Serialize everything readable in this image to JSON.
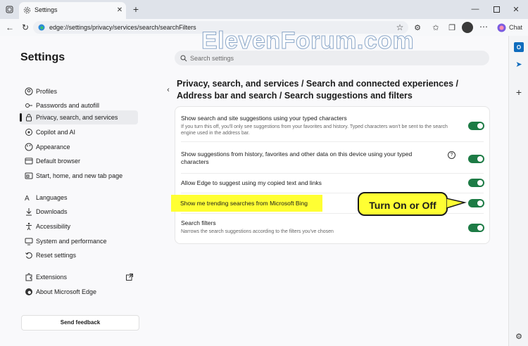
{
  "tab": {
    "title": "Settings"
  },
  "address": {
    "url": "edge://settings/privacy/services/search/searchFilters"
  },
  "toolbar": {
    "chat_label": "Chat"
  },
  "watermark": "ElevenForum.com",
  "sidebar": {
    "title": "Settings",
    "items": [
      {
        "label": "Profiles",
        "icon": "profile-icon"
      },
      {
        "label": "Passwords and autofill",
        "icon": "key-icon"
      },
      {
        "label": "Privacy, search, and services",
        "icon": "lock-icon",
        "selected": true
      },
      {
        "label": "Copilot and AI",
        "icon": "copilot-icon"
      },
      {
        "label": "Appearance",
        "icon": "palette-icon"
      },
      {
        "label": "Default browser",
        "icon": "browser-icon"
      },
      {
        "label": "Start, home, and new tab page",
        "icon": "home-icon"
      },
      {
        "label": "Languages",
        "icon": "language-icon"
      },
      {
        "label": "Downloads",
        "icon": "download-icon"
      },
      {
        "label": "Accessibility",
        "icon": "accessibility-icon"
      },
      {
        "label": "System and performance",
        "icon": "computer-icon"
      },
      {
        "label": "Reset settings",
        "icon": "reset-icon"
      },
      {
        "label": "Extensions",
        "icon": "puzzle-icon"
      },
      {
        "label": "About Microsoft Edge",
        "icon": "edge-logo-icon"
      }
    ],
    "feedback_label": "Send feedback"
  },
  "search": {
    "placeholder": "Search settings"
  },
  "breadcrumb": {
    "text": "Privacy, search, and services  /  Search and connected experiences  /  Address bar and search  /  Search suggestions and filters"
  },
  "settings": [
    {
      "title": "Show search and site suggestions using your typed characters",
      "desc": "If you turn this off, you'll only see suggestions from your favorites and history. Typed characters won't be sent to the search engine used in the address bar.",
      "on": true
    },
    {
      "title": "Show suggestions from history, favorites and other data on this device using your typed characters",
      "desc": "",
      "on": true
    },
    {
      "title": "Allow Edge to suggest using my copied text and links",
      "desc": "",
      "on": true
    },
    {
      "title": "Show me trending searches from Microsoft Bing",
      "desc": "",
      "on": true
    },
    {
      "title": "Search filters",
      "desc": "Narrows the search suggestions according to the filters you've chosen",
      "on": true
    }
  ],
  "callout": {
    "text": "Turn On or Off"
  },
  "colors": {
    "toggle_on": "#1d7b45",
    "highlight": "#ffff33"
  }
}
